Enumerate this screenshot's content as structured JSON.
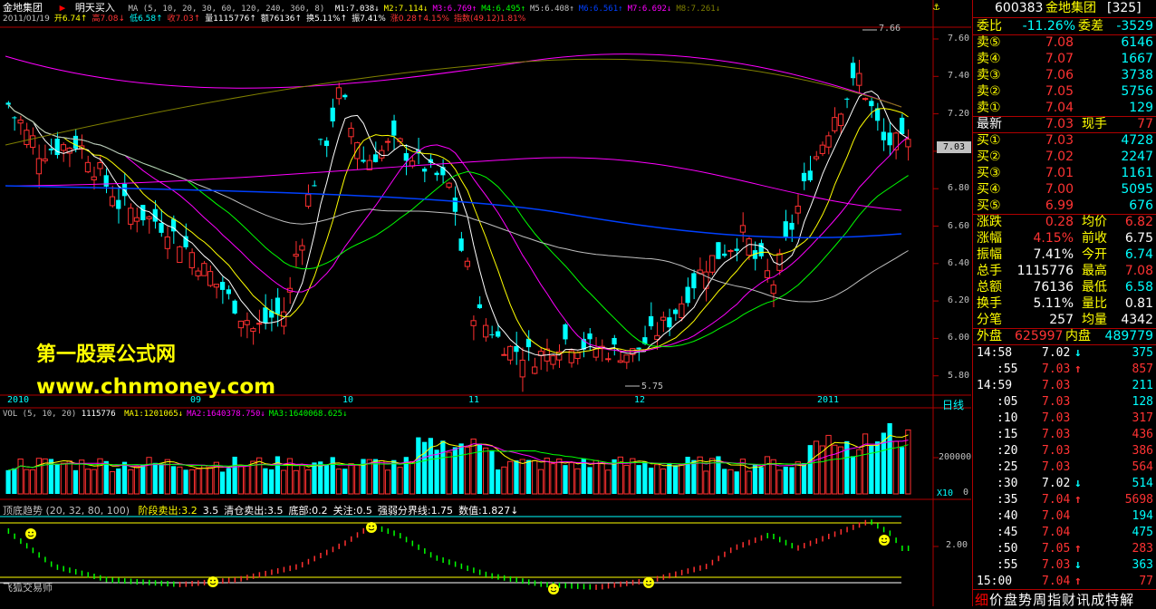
{
  "header": {
    "stock_name": "金地集团",
    "signal_label": "明天买入",
    "ma_label": "MA (5, 10, 20, 30, 60, 120, 240, 360, 8)",
    "ma_items": [
      {
        "text": "M1:7.038",
        "arrow": "↓",
        "color": "#ffffff"
      },
      {
        "text": "M2:7.114",
        "arrow": "↓",
        "color": "#ffff00"
      },
      {
        "text": "M3:6.769",
        "arrow": "↑",
        "color": "#ff00ff"
      },
      {
        "text": "M4:6.495",
        "arrow": "↑",
        "color": "#00ff00"
      },
      {
        "text": "M5:6.408",
        "arrow": "↑",
        "color": "#c0c0c0"
      },
      {
        "text": "M6:6.561",
        "arrow": "↑",
        "color": "#0040ff"
      },
      {
        "text": "M7:6.692",
        "arrow": "↓",
        "color": "#ff00ff"
      },
      {
        "text": "M8:7.261",
        "arrow": "↓",
        "color": "#808000"
      }
    ],
    "ohlc_line": [
      {
        "text": "2011/01/19",
        "color": "#c0c0c0"
      },
      {
        "text": "开6.74",
        "color": "#ffff00",
        "arrow": "↑"
      },
      {
        "text": "高7.08",
        "color": "#ff3333",
        "arrow": "↓"
      },
      {
        "text": "低6.58",
        "color": "#00ffff",
        "arrow": "↑"
      },
      {
        "text": "收7.03",
        "color": "#ff3333",
        "arrow": "↑"
      },
      {
        "text": "量1115776",
        "color": "#ffffff",
        "arrow": "↑"
      },
      {
        "text": "额76136",
        "color": "#ffffff",
        "arrow": "↑"
      },
      {
        "text": "换5.11%",
        "color": "#ffffff",
        "arrow": "↑"
      },
      {
        "text": "振7.41%",
        "color": "#ffffff",
        "arrow": ""
      },
      {
        "text": "涨0.28↑4.15%",
        "color": "#ff3333",
        "arrow": ""
      },
      {
        "text": "指数(49.12)1.81%",
        "color": "#ff3333",
        "arrow": ""
      }
    ]
  },
  "watermark": {
    "line1": "第一股票公式网",
    "line2": "www.chnmoney.com"
  },
  "price_axis": {
    "ticks": [
      "7.60",
      "7.40",
      "7.20",
      "7.00",
      "6.80",
      "6.60",
      "6.40",
      "6.20",
      "6.00",
      "5.80"
    ],
    "current_tag": "7.03",
    "high_label": "7.66",
    "low_label": "5.75"
  },
  "date_axis": {
    "labels": [
      "2010",
      "09",
      "10",
      "11",
      "12",
      "2011"
    ],
    "period_button": "日线"
  },
  "volume_panel": {
    "title": "VOL (5, 10, 20)",
    "value": "1115776",
    "items": [
      {
        "text": "MA1:1201065",
        "arrow": "↓",
        "color": "#ffff00"
      },
      {
        "text": "MA2:1640378.750",
        "arrow": "↓",
        "color": "#ff00ff"
      },
      {
        "text": "MA3:1640068.625",
        "arrow": "↓",
        "color": "#00ff00"
      }
    ],
    "axis_ticks": [
      "200000",
      "0"
    ],
    "multiplier": "X10"
  },
  "indicator_panel": {
    "title": "顶底趋势 (20, 32, 80, 100)",
    "items": [
      {
        "text": "阶段卖出:3.2",
        "color": "#ffff00"
      },
      {
        "text": "3.5",
        "color": "#ffffff"
      },
      {
        "text": "清仓卖出:3.5",
        "color": "#ffffff"
      },
      {
        "text": "底部:0.2",
        "color": "#ffffff"
      },
      {
        "text": "关注:0.5",
        "color": "#ffffff"
      },
      {
        "text": "强弱分界线:1.75",
        "color": "#ffffff"
      },
      {
        "text": "数值:1.827",
        "color": "#ffffff",
        "arrow": "↓"
      }
    ],
    "axis_tick": "2.00",
    "footer_label": "飞狐交易师"
  },
  "quote": {
    "code": "600383",
    "name": "金地集团",
    "sector": "[325]",
    "ratio_label": "委比",
    "ratio_value": "-11.26%",
    "diff_label": "委差",
    "diff_value": "-3529",
    "asks": [
      {
        "label": "卖⑤",
        "price": "7.08",
        "vol": "6146"
      },
      {
        "label": "卖④",
        "price": "7.07",
        "vol": "1667"
      },
      {
        "label": "卖③",
        "price": "7.06",
        "vol": "3738"
      },
      {
        "label": "卖②",
        "price": "7.05",
        "vol": "5756"
      },
      {
        "label": "卖①",
        "price": "7.04",
        "vol": "129"
      }
    ],
    "last": {
      "label": "最新",
      "price": "7.03",
      "label2": "现手",
      "vol": "77"
    },
    "bids": [
      {
        "label": "买①",
        "price": "7.03",
        "vol": "4728"
      },
      {
        "label": "买②",
        "price": "7.02",
        "vol": "2247"
      },
      {
        "label": "买③",
        "price": "7.01",
        "vol": "1161"
      },
      {
        "label": "买④",
        "price": "7.00",
        "vol": "5095"
      },
      {
        "label": "买⑤",
        "price": "6.99",
        "vol": "676"
      }
    ],
    "stats": [
      {
        "l1": "涨跌",
        "v1": "0.28",
        "c1": "#ff3333",
        "l2": "均价",
        "v2": "6.82",
        "c2": "#ff3333"
      },
      {
        "l1": "涨幅",
        "v1": "4.15%",
        "c1": "#ff3333",
        "l2": "前收",
        "v2": "6.75",
        "c2": "#ffffff"
      },
      {
        "l1": "振幅",
        "v1": "7.41%",
        "c1": "#ffffff",
        "l2": "今开",
        "v2": "6.74",
        "c2": "#00ffff"
      },
      {
        "l1": "总手",
        "v1": "1115776",
        "c1": "#ffffff",
        "l2": "最高",
        "v2": "7.08",
        "c2": "#ff3333"
      },
      {
        "l1": "总额",
        "v1": "76136",
        "c1": "#ffffff",
        "l2": "最低",
        "v2": "6.58",
        "c2": "#00ffff"
      },
      {
        "l1": "换手",
        "v1": "5.11%",
        "c1": "#ffffff",
        "l2": "量比",
        "v2": "0.81",
        "c2": "#ffffff"
      },
      {
        "l1": "分笔",
        "v1": "257",
        "c1": "#ffffff",
        "l2": "均量",
        "v2": "4342",
        "c2": "#ffffff"
      }
    ],
    "outer_label": "外盘",
    "outer_value": "625997",
    "inner_label": "内盘",
    "inner_value": "489779",
    "ticks": [
      {
        "time": "14:58",
        "price": "7.02",
        "arrow": "↓",
        "vol": "375",
        "pc": "#ffffff",
        "ac": "#00ffff",
        "vc": "#00ffff"
      },
      {
        "time": ":55",
        "price": "7.03",
        "arrow": "↑",
        "vol": "857",
        "pc": "#ff3333",
        "ac": "#ff3333",
        "vc": "#ff3333"
      },
      {
        "time": "14:59",
        "price": "7.03",
        "arrow": "",
        "vol": "211",
        "pc": "#ff3333",
        "ac": "#ff3333",
        "vc": "#00ffff"
      },
      {
        "time": ":05",
        "price": "7.03",
        "arrow": "",
        "vol": "128",
        "pc": "#ff3333",
        "ac": "#ff3333",
        "vc": "#00ffff"
      },
      {
        "time": ":10",
        "price": "7.03",
        "arrow": "",
        "vol": "317",
        "pc": "#ff3333",
        "ac": "#ff3333",
        "vc": "#ff3333"
      },
      {
        "time": ":15",
        "price": "7.03",
        "arrow": "",
        "vol": "436",
        "pc": "#ff3333",
        "ac": "#ff3333",
        "vc": "#ff3333"
      },
      {
        "time": ":20",
        "price": "7.03",
        "arrow": "",
        "vol": "386",
        "pc": "#ff3333",
        "ac": "#ff3333",
        "vc": "#ff3333"
      },
      {
        "time": ":25",
        "price": "7.03",
        "arrow": "",
        "vol": "564",
        "pc": "#ff3333",
        "ac": "#ff3333",
        "vc": "#ff3333"
      },
      {
        "time": ":30",
        "price": "7.02",
        "arrow": "↓",
        "vol": "514",
        "pc": "#ffffff",
        "ac": "#00ffff",
        "vc": "#00ffff"
      },
      {
        "time": ":35",
        "price": "7.04",
        "arrow": "↑",
        "vol": "5698",
        "pc": "#ff3333",
        "ac": "#ff3333",
        "vc": "#ff3333"
      },
      {
        "time": ":40",
        "price": "7.04",
        "arrow": "",
        "vol": "194",
        "pc": "#ff3333",
        "ac": "#ff3333",
        "vc": "#00ffff"
      },
      {
        "time": ":45",
        "price": "7.04",
        "arrow": "",
        "vol": "475",
        "pc": "#ff3333",
        "ac": "#ff3333",
        "vc": "#00ffff"
      },
      {
        "time": ":50",
        "price": "7.05",
        "arrow": "↑",
        "vol": "283",
        "pc": "#ff3333",
        "ac": "#ff3333",
        "vc": "#ff3333"
      },
      {
        "time": ":55",
        "price": "7.03",
        "arrow": "↓",
        "vol": "363",
        "pc": "#ff3333",
        "ac": "#00ffff",
        "vc": "#00ffff"
      },
      {
        "time": "15:00",
        "price": "7.04",
        "arrow": "↑",
        "vol": "77",
        "pc": "#ff3333",
        "ac": "#ff3333",
        "vc": "#ff3333"
      }
    ],
    "bottom_tabs": [
      "细",
      "价",
      "盘",
      "势",
      "周",
      "指",
      "财",
      "讯",
      "成",
      "特",
      "解"
    ]
  }
}
